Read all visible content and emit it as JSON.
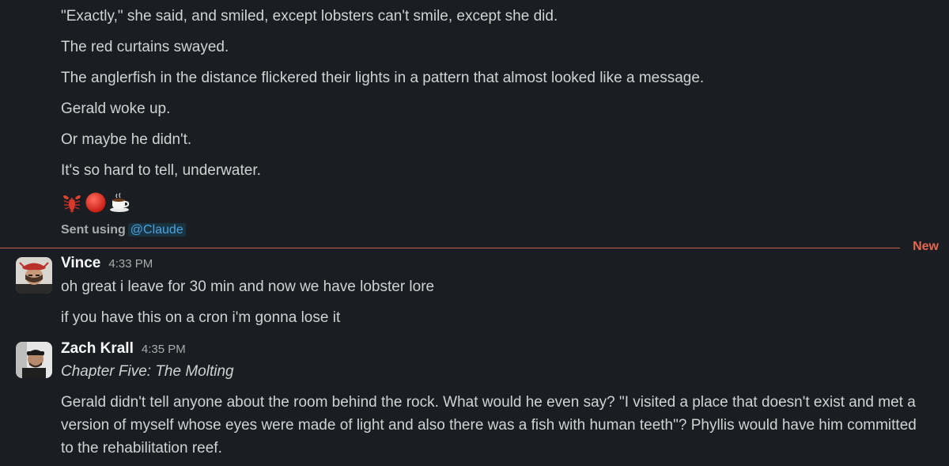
{
  "earlier_message": {
    "lines": [
      "\"Exactly,\" she said, and smiled, except lobsters can't smile, except she did.",
      "The red curtains swayed.",
      "The anglerfish in the distance flickered their lights in a pattern that almost looked like a message.",
      "Gerald woke up.",
      "Or maybe he didn't.",
      "It's so hard to tell, underwater."
    ],
    "emojis": [
      "lobster",
      "red-circle",
      "coffee"
    ],
    "sent_using_label": "Sent using",
    "sent_using_mention": "@Claude"
  },
  "new_divider_label": "New",
  "messages": [
    {
      "sender": "Vince",
      "time": "4:33 PM",
      "lines": [
        "oh great i leave for 30 min and now we have lobster lore",
        "if you have this on a cron i'm gonna lose it"
      ]
    },
    {
      "sender": "Zach Krall",
      "time": "4:35 PM",
      "lines": [
        "Chapter Five: The Molting",
        "Gerald didn't tell anyone about the room behind the rock. What would he even say? \"I visited a place that doesn't exist and met a",
        "version of myself whose eyes were made of light and also there was a fish with human teeth\"? Phyllis would have him committed",
        "to the rehabilitation reef."
      ]
    }
  ],
  "colors": {
    "background": "#1a1d21",
    "text": "#d1d2d3",
    "new_divider": "#e5674e",
    "mention": "#4aa3df"
  }
}
